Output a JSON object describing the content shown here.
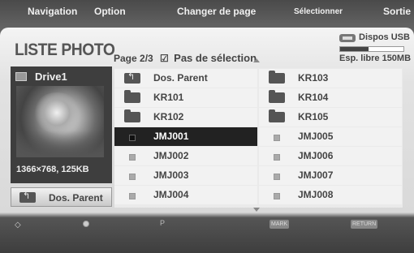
{
  "title": "LISTE PHOTO",
  "page_info": {
    "page": "Page 2/3",
    "selection": "Pas de sélection"
  },
  "usb": {
    "label": "Dispos USB",
    "free": "Esp. libre 150MB",
    "usage_fraction": 0.45
  },
  "left_panel": {
    "drive": "Drive1",
    "image_info": "1366×768, 125KB",
    "parent_button": "Dos. Parent"
  },
  "files": {
    "left": [
      {
        "label": "Dos. Parent",
        "icon": "folder-up-icon"
      },
      {
        "label": "KR101",
        "icon": "folder-icon"
      },
      {
        "label": "KR102",
        "icon": "folder-icon"
      },
      {
        "label": "JMJ001",
        "icon": "file-icon",
        "selected": true
      },
      {
        "label": "JMJ002",
        "icon": "file-icon"
      },
      {
        "label": "JMJ003",
        "icon": "file-icon"
      },
      {
        "label": "JMJ004",
        "icon": "file-icon"
      }
    ],
    "right": [
      {
        "label": "KR103",
        "icon": "folder-icon"
      },
      {
        "label": "KR104",
        "icon": "folder-icon"
      },
      {
        "label": "KR105",
        "icon": "folder-icon"
      },
      {
        "label": "JMJ005",
        "icon": "file-icon"
      },
      {
        "label": "JMJ006",
        "icon": "file-icon"
      },
      {
        "label": "JMJ007",
        "icon": "file-icon"
      },
      {
        "label": "JMJ008",
        "icon": "file-icon"
      }
    ]
  },
  "bottom": {
    "navigation": "Navigation",
    "option": "Option",
    "page_change": "Changer de page",
    "mark_key": "MARK",
    "select": "Sélectionner",
    "return_key": "RETURN",
    "exit": "Sortie",
    "p_key": "P"
  }
}
